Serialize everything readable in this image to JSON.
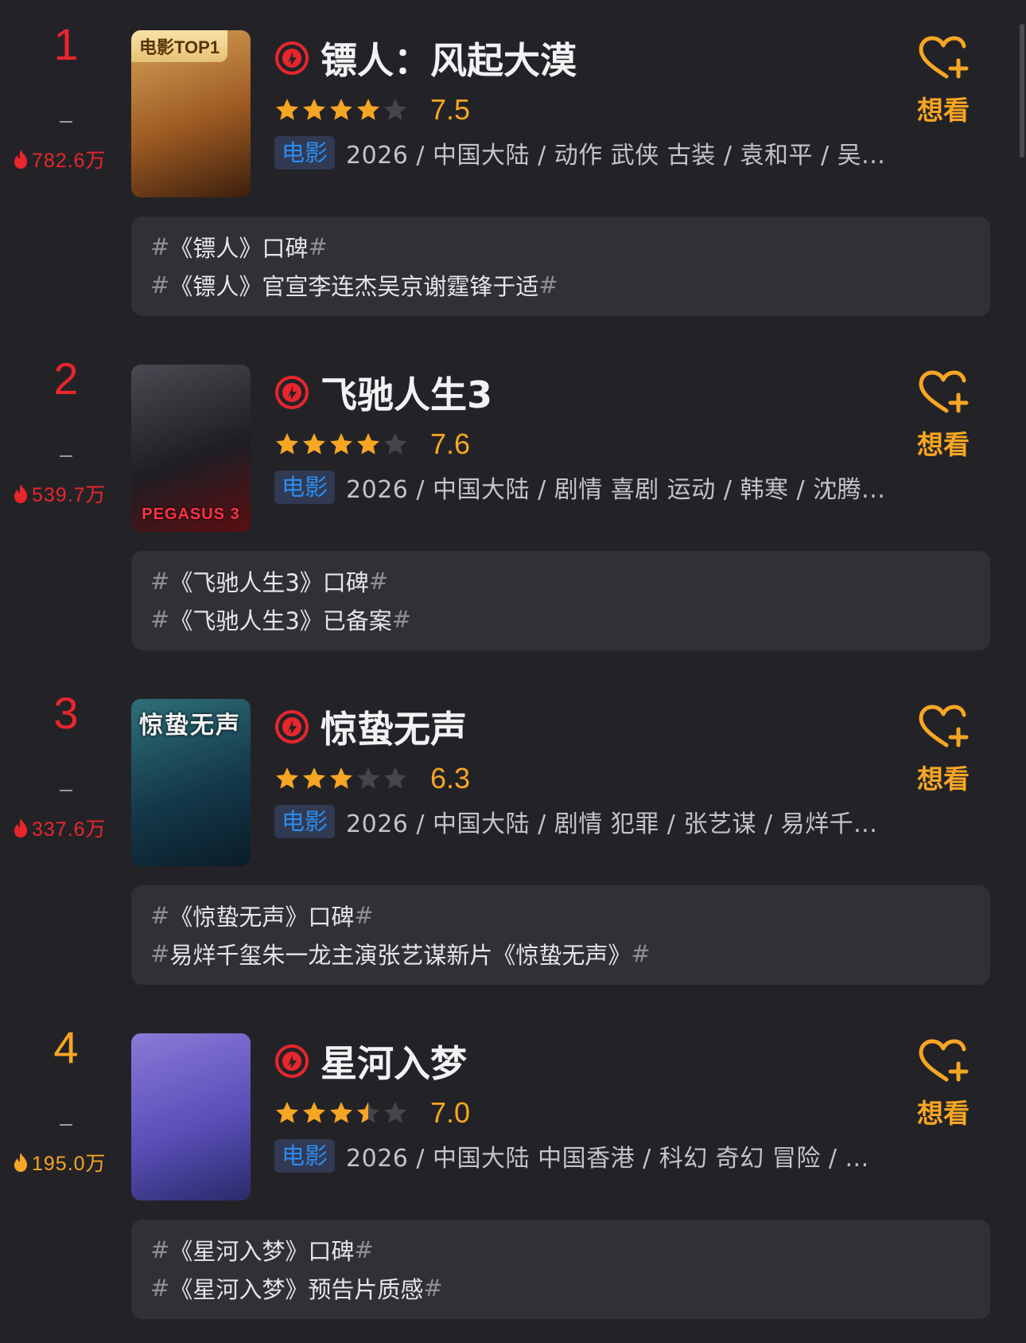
{
  "colors": {
    "rank_top3": "#e8262c",
    "rank_other": "#f7a623",
    "heat_top3": "#e8262c",
    "heat_other": "#f7a623",
    "star_filled": "#f7a623",
    "star_empty": "#45454b",
    "accent": "#f7a623",
    "tag_text": "#2c8cf0"
  },
  "icons": {
    "play": "play-badge-icon",
    "flame": "flame-icon",
    "want": "heart-plus-icon",
    "star": "star-icon"
  },
  "want_label": "想看",
  "movies": [
    {
      "rank": "1",
      "dash": "–",
      "heat": "782.6万",
      "title": "镖人：风起大漠",
      "stars": 4,
      "score": "7.5",
      "tag": "电影",
      "meta": "2026 / 中国大陆 / 动作 武侠 古装 / 袁和平 / 吴...",
      "poster_badge": "电影TOP1",
      "poster_text": "",
      "poster_vtitle": "",
      "poster_colors": [
        "#d9a45a",
        "#9c5a22",
        "#3c1f0d"
      ],
      "topics": [
        {
          "lead": "#",
          "text": "《镖人》口碑",
          "trail": "#"
        },
        {
          "lead": "#",
          "text": "《镖人》官宣李连杰吴京谢霆锋于适",
          "trail": "#"
        }
      ]
    },
    {
      "rank": "2",
      "dash": "–",
      "heat": "539.7万",
      "title": "飞驰人生3",
      "stars": 4,
      "score": "7.6",
      "tag": "电影",
      "meta": "2026 / 中国大陆 / 剧情 喜剧 运动 / 韩寒 / 沈腾...",
      "poster_badge": "",
      "poster_text": "PEGASUS 3",
      "poster_vtitle": "",
      "poster_colors": [
        "#4a4a52",
        "#1e1e24",
        "#5a0f12"
      ],
      "topics": [
        {
          "lead": "#",
          "text": "《飞驰人生3》口碑",
          "trail": "#"
        },
        {
          "lead": "#",
          "text": "《飞驰人生3》已备案",
          "trail": "#"
        }
      ]
    },
    {
      "rank": "3",
      "dash": "–",
      "heat": "337.6万",
      "title": "惊蛰无声",
      "stars": 3,
      "score": "6.3",
      "tag": "电影",
      "meta": "2026 / 中国大陆 / 剧情 犯罪 / 张艺谋 / 易烊千...",
      "poster_badge": "",
      "poster_text": "",
      "poster_vtitle": "惊蛰无声",
      "poster_colors": [
        "#2f6f7a",
        "#14394a",
        "#0a1c28"
      ],
      "topics": [
        {
          "lead": "#",
          "text": "《惊蛰无声》口碑",
          "trail": "#"
        },
        {
          "lead": "#",
          "text": "易烊千玺朱一龙主演张艺谋新片《惊蛰无声》",
          "trail": "#"
        }
      ]
    },
    {
      "rank": "4",
      "dash": "–",
      "heat": "195.0万",
      "title": "星河入梦",
      "stars": 3.5,
      "score": "7.0",
      "tag": "电影",
      "meta": "2026 / 中国大陆 中国香港 / 科幻 奇幻 冒险 / ...",
      "poster_badge": "",
      "poster_text": "",
      "poster_vtitle": "",
      "poster_colors": [
        "#8a7ad8",
        "#5a4fb8",
        "#2a2a6a"
      ],
      "topics": [
        {
          "lead": "#",
          "text": "《星河入梦》口碑",
          "trail": "#"
        },
        {
          "lead": "#",
          "text": "《星河入梦》预告片质感",
          "trail": "#"
        }
      ]
    }
  ]
}
